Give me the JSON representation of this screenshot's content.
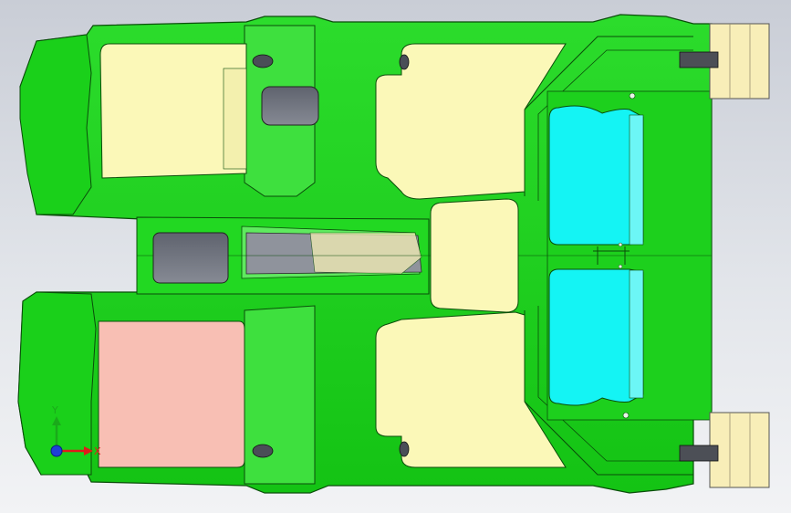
{
  "viewport": {
    "background_top": "#c9cdd6",
    "background_bottom": "#f2f3f5"
  },
  "colors": {
    "body_green": "#1fd31f",
    "edge_dark": "#0a4d0a",
    "highlight_green": "#6ff26f",
    "cream_panel": "#fbf8b8",
    "pink_panel": "#f8bfb4",
    "cyan_panel": "#14f4f4",
    "hole_gray": "#6b6f7a",
    "bracket_cream": "#f8eeb8"
  },
  "triad": {
    "x_label": "X",
    "y_label": "Y",
    "x_color": "#e01b1b",
    "y_color": "#1aaa1a",
    "z_color": "#1f3fd8"
  },
  "icons": [
    "coordinate-triad-icon"
  ]
}
